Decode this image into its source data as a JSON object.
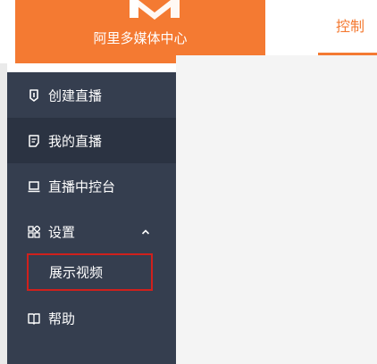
{
  "header": {
    "logo_text": "阿里多媒体中心",
    "tab_label": "控制",
    "accent": "#f47a32"
  },
  "sidebar": {
    "bg": "#353e4f",
    "active_bg": "#2b3342",
    "items": [
      {
        "label": "创建直播",
        "icon": "tag-icon"
      },
      {
        "label": "我的直播",
        "icon": "document-icon",
        "active": true
      },
      {
        "label": "直播中控台",
        "icon": "monitor-icon"
      },
      {
        "label": "设置",
        "icon": "grid-icon",
        "expanded": true
      },
      {
        "label": "帮助",
        "icon": "book-icon"
      }
    ],
    "settings_submenu": [
      {
        "label": "展示视频",
        "highlight": "#d0201c"
      }
    ]
  }
}
